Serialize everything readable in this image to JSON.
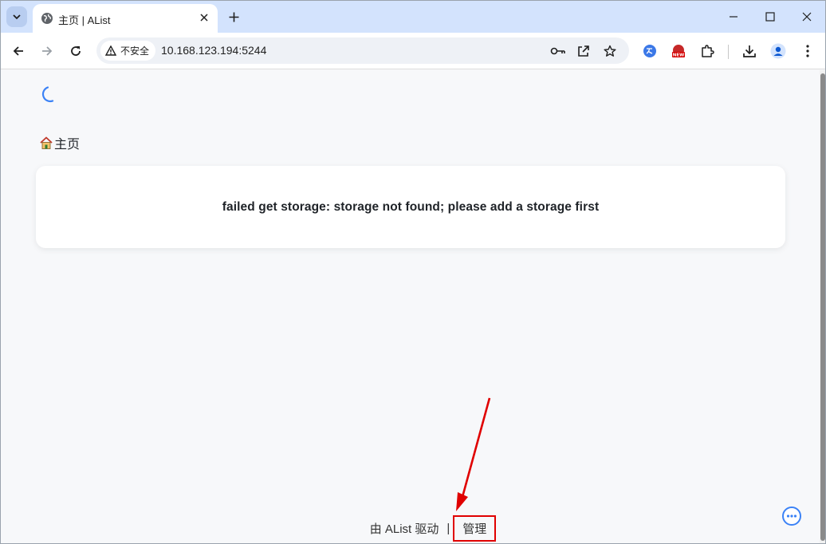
{
  "browser": {
    "tab_title": "主页 | AList",
    "url": "10.168.123.194:5244",
    "security_label": "不安全"
  },
  "page": {
    "breadcrumb_home": "主页",
    "error_message": "failed get storage: storage not found; please add a storage first",
    "footer_powered": "由 AList 驱动",
    "footer_separator": "|",
    "footer_admin": "管理"
  },
  "colors": {
    "accent": "#3b82f6",
    "annotation_red": "#e00000",
    "tabstrip": "#d3e3fd"
  },
  "icons": [
    "chevron-down-icon",
    "globe-icon",
    "close-icon",
    "plus-icon",
    "minimize-icon",
    "maximize-icon",
    "back-icon",
    "forward-icon",
    "reload-icon",
    "warning-icon",
    "key-icon",
    "share-icon",
    "star-icon",
    "translate-icon",
    "extension-new-icon",
    "puzzle-icon",
    "download-icon",
    "profile-icon",
    "more-vert-icon",
    "spinner-icon",
    "home-icon",
    "more-horizontal-icon"
  ]
}
